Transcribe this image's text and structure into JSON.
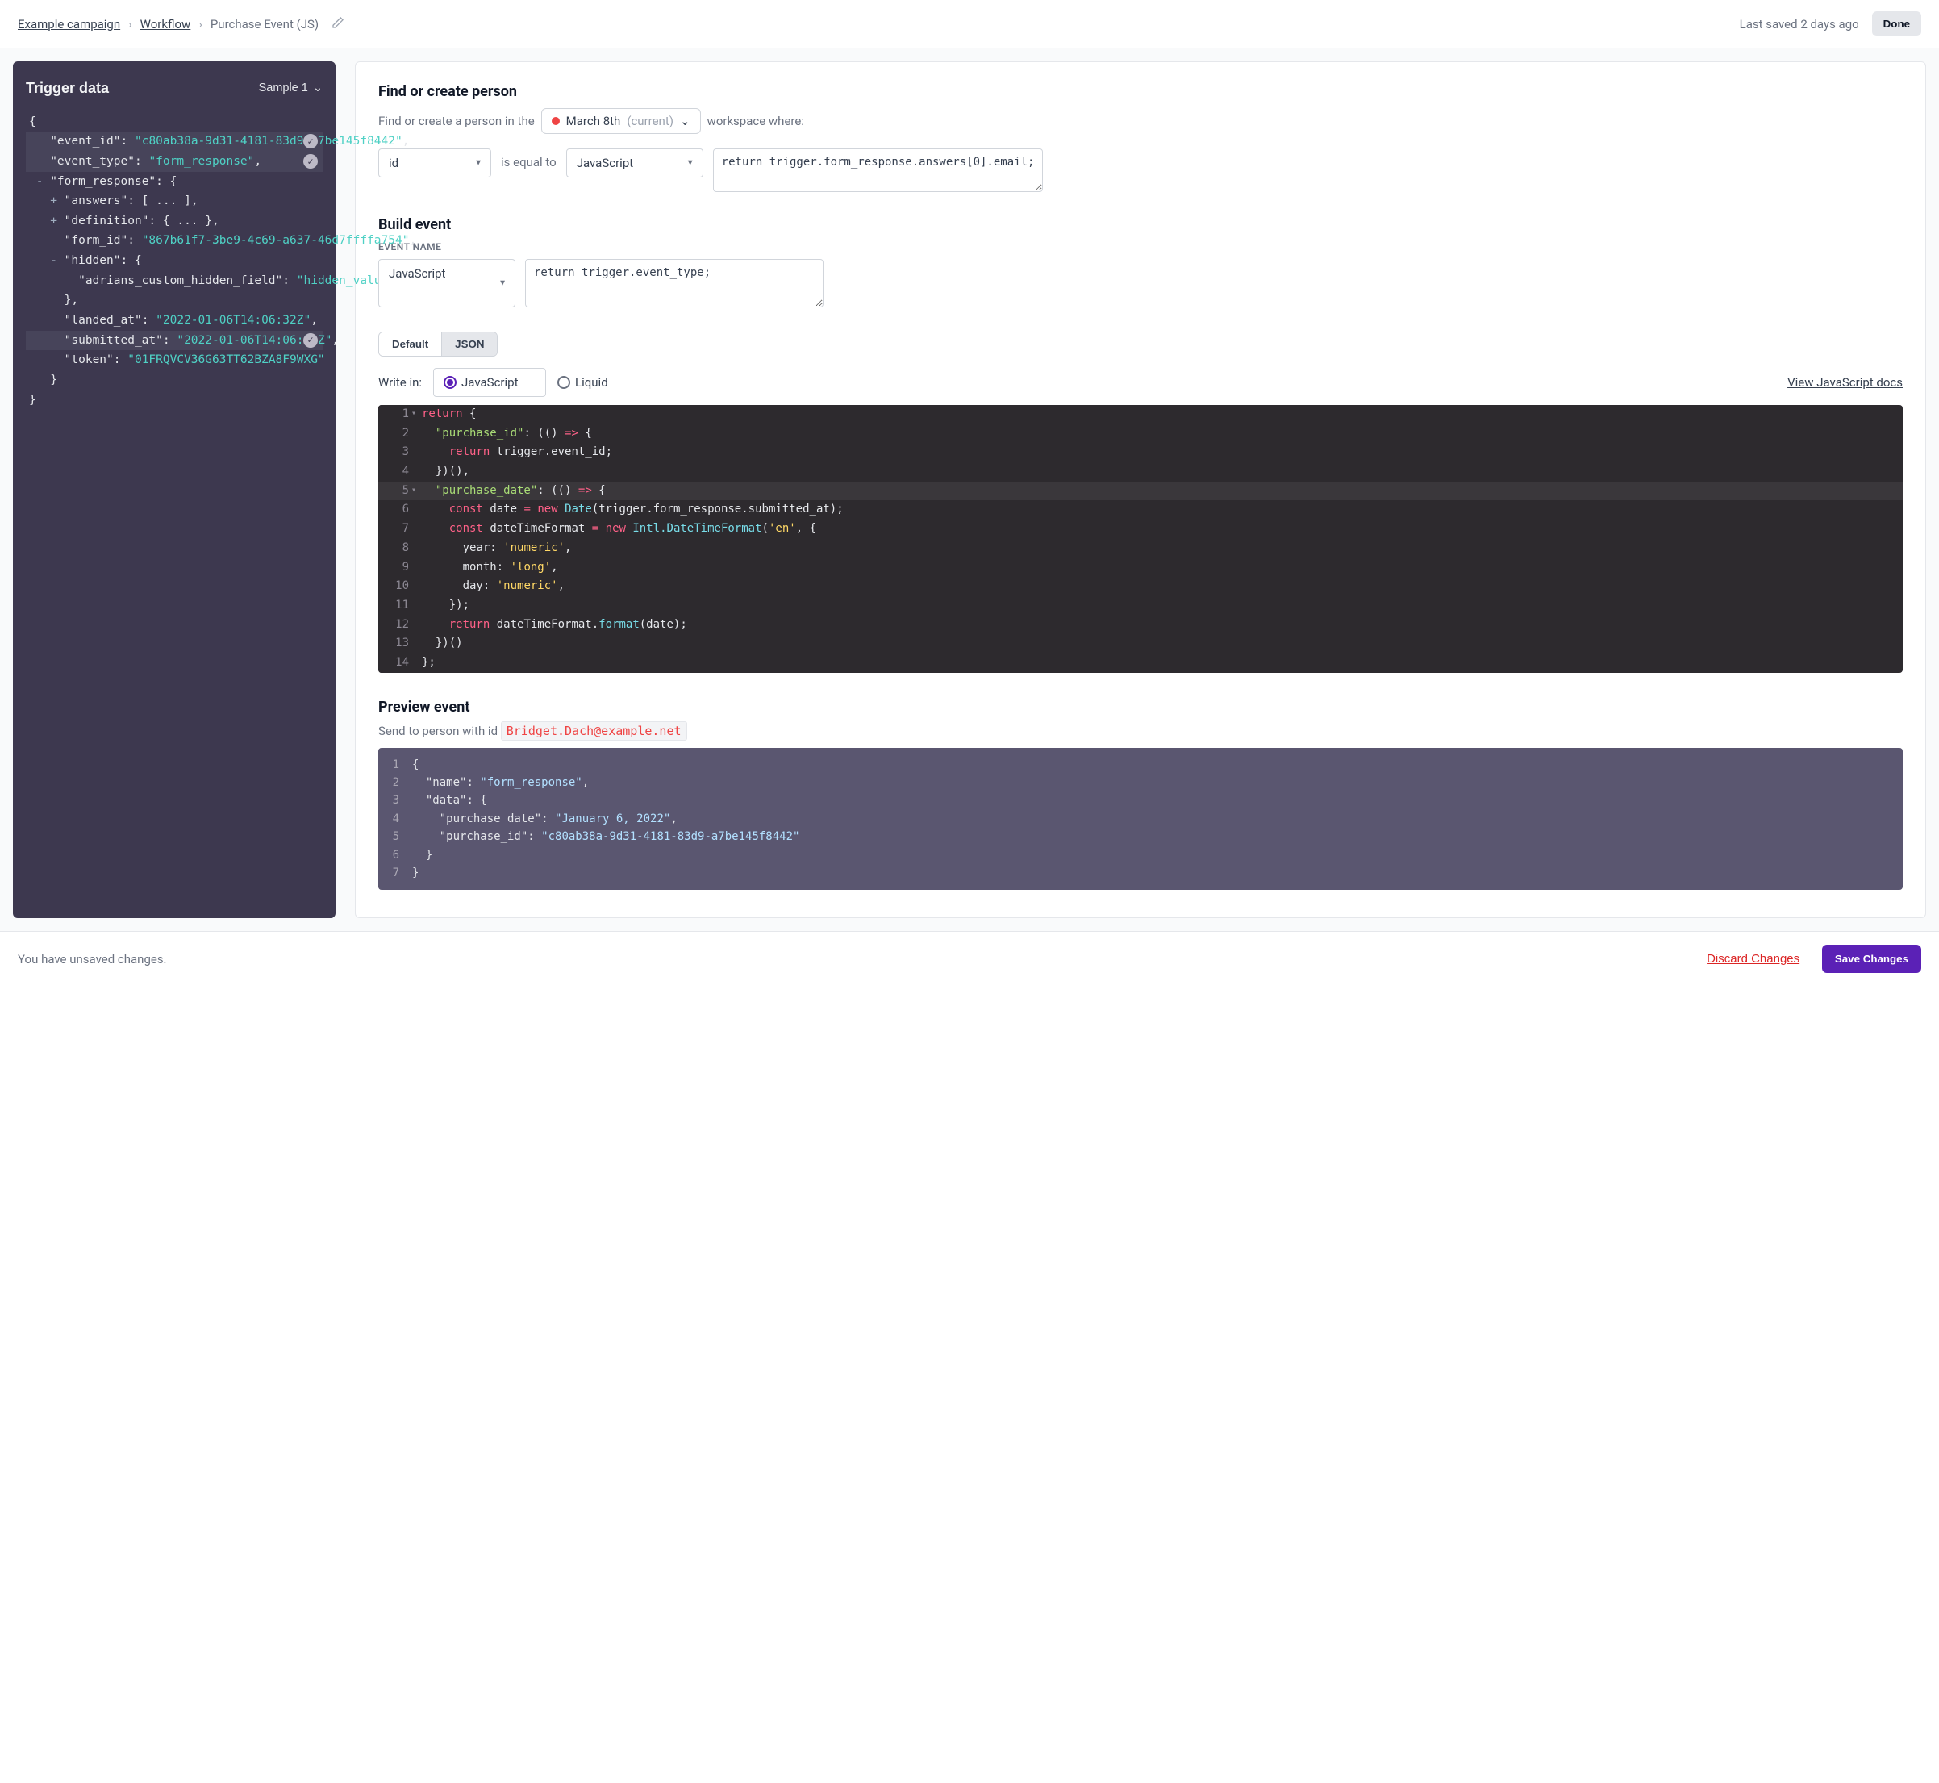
{
  "breadcrumbs": {
    "campaign": "Example campaign",
    "workflow": "Workflow",
    "current": "Purchase Event (JS)"
  },
  "top": {
    "saved": "Last saved 2 days ago",
    "done": "Done"
  },
  "trigger": {
    "title": "Trigger data",
    "sample_label": "Sample 1",
    "json": {
      "open_brace": "{",
      "event_id_k": "\"event_id\"",
      "event_id_v": "\"c80ab38a-9d31-4181-83d9-a7be145f8442\"",
      "event_type_k": "\"event_type\"",
      "event_type_v": "\"form_response\"",
      "form_response_k": "\"form_response\"",
      "answers_k": "\"answers\"",
      "answers_v": "[ ... ]",
      "definition_k": "\"definition\"",
      "definition_v": "{ ... }",
      "form_id_k": "\"form_id\"",
      "form_id_v": "\"867b61f7-3be9-4c69-a637-46d7ffffa754\"",
      "hidden_k": "\"hidden\"",
      "adrian_k": "\"adrians_custom_hidden_field\"",
      "adrian_v": "\"hidden_value\"",
      "landed_k": "\"landed_at\"",
      "landed_v": "\"2022-01-06T14:06:32Z\"",
      "submitted_k": "\"submitted_at\"",
      "submitted_v": "\"2022-01-06T14:06:32Z\"",
      "token_k": "\"token\"",
      "token_v": "\"01FRQVCV36G63TT62BZA8F9WXG\""
    }
  },
  "find": {
    "heading": "Find or create person",
    "lead": "Find or create a person in the ",
    "workspace_name": "March 8th",
    "current": "(current)",
    "tail": " workspace where:",
    "lhs": "id",
    "op": "is equal to",
    "rhs_type": "JavaScript",
    "rhs_code": "return trigger.form_response.answers[0].email;"
  },
  "build": {
    "heading": "Build event",
    "label": "EVENT NAME",
    "type": "JavaScript",
    "code": "return trigger.event_type;",
    "tabs": {
      "default": "Default",
      "json": "JSON"
    },
    "writein": "Write in:",
    "lang_js": "JavaScript",
    "lang_liquid": "Liquid",
    "docs": "View JavaScript docs"
  },
  "editor": {
    "lines": [
      "return {",
      "  \"purchase_id\": (() => {",
      "    return trigger.event_id;",
      "  })(),",
      "  \"purchase_date\": (() => {",
      "    const date = new Date(trigger.form_response.submitted_at);",
      "    const dateTimeFormat = new Intl.DateTimeFormat('en', {",
      "      year: 'numeric',",
      "      month: 'long',",
      "      day: 'numeric',",
      "    });",
      "    return dateTimeFormat.format(date);",
      "  })()",
      "};"
    ]
  },
  "preview": {
    "heading": "Preview event",
    "send_lead": "Send to person with id ",
    "email": "Bridget.Dach@example.net",
    "json": {
      "l1": "{",
      "l2": "  \"name\": \"form_response\",",
      "l3": "  \"data\": {",
      "l4": "    \"purchase_date\": \"January 6, 2022\",",
      "l5": "    \"purchase_id\": \"c80ab38a-9d31-4181-83d9-a7be145f8442\"",
      "l6": "  }",
      "l7": "}"
    }
  },
  "footer": {
    "unsaved": "You have unsaved changes.",
    "discard": "Discard Changes",
    "save": "Save Changes"
  }
}
